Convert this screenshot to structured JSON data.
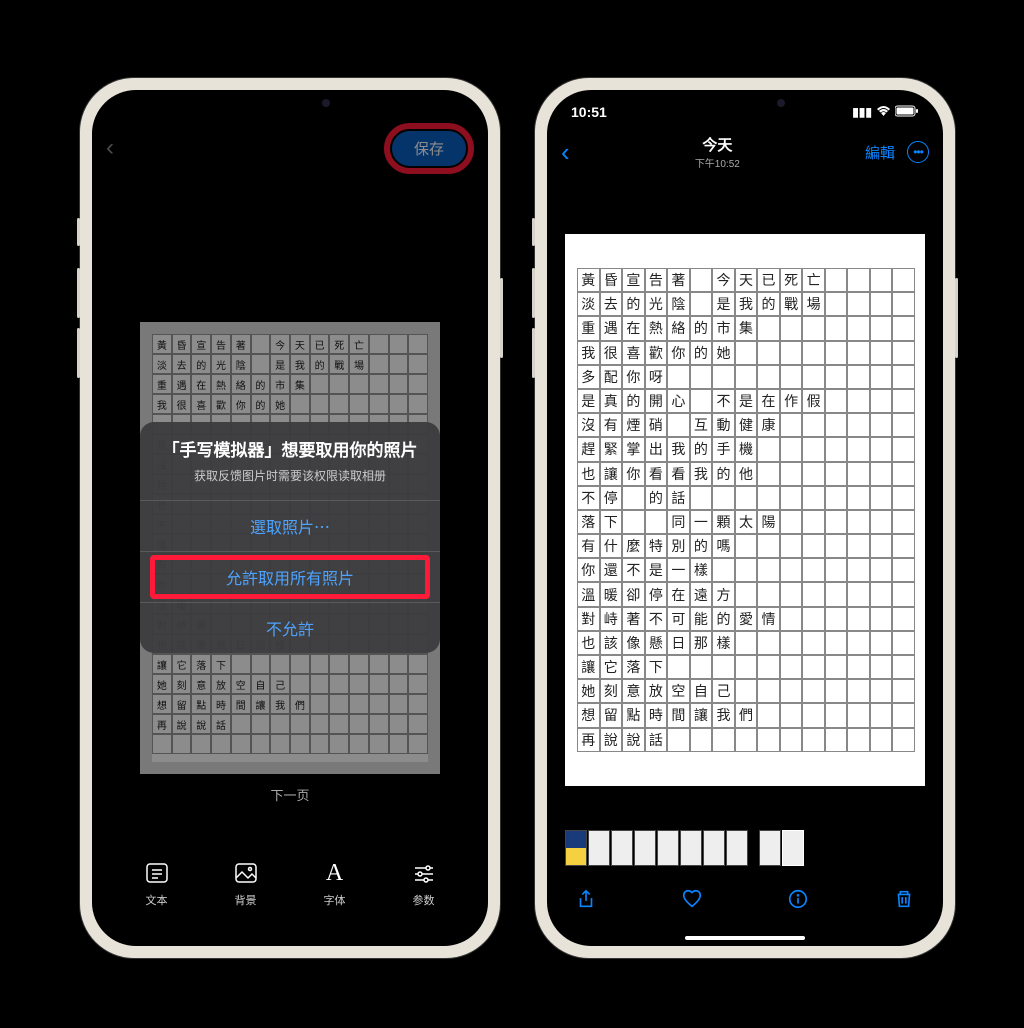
{
  "left": {
    "save_label": "保存",
    "pager": "下一页",
    "alert": {
      "title": "「手写模拟器」想要取用你的照片",
      "message": "获取反馈图片时需要该权限读取相册",
      "select": "選取照片⋯",
      "allow_all": "允許取用所有照片",
      "deny": "不允許"
    },
    "tabs": [
      {
        "label": "文本"
      },
      {
        "label": "背景"
      },
      {
        "label": "字体"
      },
      {
        "label": "参数"
      }
    ],
    "grid_rows": [
      "黃昏宣告著 今天已死亡",
      "淡去的光陰 是我的戰場",
      "重遇在熱絡的市集",
      "我很喜歡你的她",
      "",
      "是",
      "沒",
      "趕",
      "也",
      "不",
      "落",
      "有",
      "你",
      "溫暖",
      "對峙著",
      "也該像懸日那樣",
      "讓它落下",
      "她刻意放空自己",
      "想留點時間讓我們",
      "再說說話"
    ]
  },
  "right": {
    "status_time": "10:51",
    "title": "今天",
    "subtitle": "下午10:52",
    "edit": "編輯",
    "grid_rows": [
      "黃昏宣告著 今天已死亡",
      "淡去的光陰 是我的戰場",
      "重遇在熱絡的市集",
      "我很喜歡你的她",
      "多配你呀",
      "是真的開心 不是在作假",
      "沒有煙硝 互動健康",
      "趕緊掌出我的手機",
      "也讓你看看我的他",
      "不停 的話",
      "落下  同一顆太陽",
      "有什麼特別的嗎",
      "你還不是一樣",
      "溫暖卻停在遠方",
      "對峙著不可能的愛情",
      "也該像懸日那樣",
      "讓它落下",
      "她刻意放空自己",
      "想留點時間讓我們",
      "再說說話"
    ]
  }
}
